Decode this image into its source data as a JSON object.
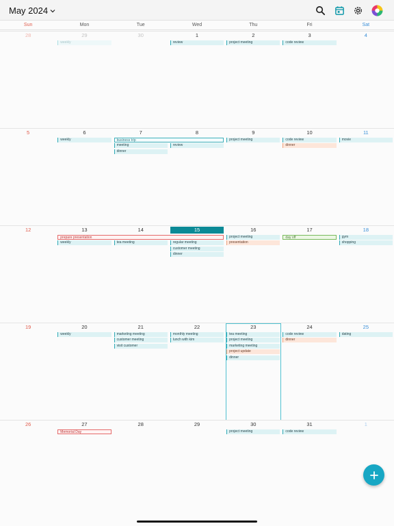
{
  "header": {
    "month_label": "May 2024",
    "icons": [
      "search-icon",
      "calendar-today-icon",
      "gear-icon",
      "color-wheel-icon"
    ],
    "accent_color": "#1199aa"
  },
  "weekdays": [
    "Sun",
    "Mon",
    "Tue",
    "Wed",
    "Thu",
    "Fri",
    "Sat"
  ],
  "weeks": [
    {
      "days": [
        {
          "num": "28",
          "muted": true
        },
        {
          "num": "29",
          "muted": true
        },
        {
          "num": "30",
          "muted": true
        },
        {
          "num": "1"
        },
        {
          "num": "2"
        },
        {
          "num": "3"
        },
        {
          "num": "4"
        }
      ],
      "events": [
        {
          "label": "weekly",
          "day": 1,
          "row": 0,
          "style": "std faded"
        },
        {
          "label": "review",
          "day": 3,
          "row": 0,
          "style": "std"
        },
        {
          "label": "project meeting",
          "day": 4,
          "row": 0,
          "style": "std"
        },
        {
          "label": "code review",
          "day": 5,
          "row": 0,
          "style": "std"
        }
      ]
    },
    {
      "days": [
        {
          "num": "5"
        },
        {
          "num": "6"
        },
        {
          "num": "7"
        },
        {
          "num": "8"
        },
        {
          "num": "9"
        },
        {
          "num": "10"
        },
        {
          "num": "11"
        }
      ],
      "events": [
        {
          "label": "weekly",
          "day": 1,
          "row": 0,
          "style": "std"
        },
        {
          "label": "business trip",
          "day": 2,
          "span": 2,
          "row": 0,
          "style": "outline-teal"
        },
        {
          "label": "project meeting",
          "day": 4,
          "row": 0,
          "style": "std"
        },
        {
          "label": "code review",
          "day": 5,
          "row": 0,
          "style": "std"
        },
        {
          "label": "movie",
          "day": 6,
          "row": 0,
          "style": "std"
        },
        {
          "label": "meeting",
          "day": 2,
          "row": 1,
          "style": "std"
        },
        {
          "label": "review",
          "day": 3,
          "row": 1,
          "style": "std"
        },
        {
          "label": "dinner",
          "day": 5,
          "row": 1,
          "style": "peach"
        },
        {
          "label": "dinner",
          "day": 2,
          "row": 2,
          "style": "std"
        }
      ]
    },
    {
      "days": [
        {
          "num": "12"
        },
        {
          "num": "13"
        },
        {
          "num": "14"
        },
        {
          "num": "15",
          "today": true
        },
        {
          "num": "16"
        },
        {
          "num": "17"
        },
        {
          "num": "18"
        }
      ],
      "events": [
        {
          "label": "prepare presentation",
          "day": 1,
          "span": 3,
          "row": 0,
          "style": "outline-red"
        },
        {
          "label": "project meeting",
          "day": 4,
          "row": 0,
          "style": "std"
        },
        {
          "label": "day off",
          "day": 5,
          "row": 0,
          "style": "outline-green"
        },
        {
          "label": "gym",
          "day": 6,
          "row": 0,
          "style": "std"
        },
        {
          "label": "weekly",
          "day": 1,
          "row": 1,
          "style": "std"
        },
        {
          "label": "tea meeting",
          "day": 2,
          "row": 1,
          "style": "std"
        },
        {
          "label": "regular meeting",
          "day": 3,
          "row": 1,
          "style": "std"
        },
        {
          "label": "presentation",
          "day": 4,
          "row": 1,
          "style": "peach"
        },
        {
          "label": "shopping",
          "day": 6,
          "row": 1,
          "style": "std"
        },
        {
          "label": "customer meeting",
          "day": 3,
          "row": 2,
          "style": "std"
        },
        {
          "label": "dinner",
          "day": 3,
          "row": 3,
          "style": "std"
        }
      ]
    },
    {
      "selected_day": 4,
      "days": [
        {
          "num": "19"
        },
        {
          "num": "20"
        },
        {
          "num": "21"
        },
        {
          "num": "22"
        },
        {
          "num": "23"
        },
        {
          "num": "24"
        },
        {
          "num": "25"
        }
      ],
      "events": [
        {
          "label": "weekly",
          "day": 1,
          "row": 0,
          "style": "std"
        },
        {
          "label": "marketing meeting",
          "day": 2,
          "row": 0,
          "style": "std"
        },
        {
          "label": "monthly meeting",
          "day": 3,
          "row": 0,
          "style": "std"
        },
        {
          "label": "tea meeting",
          "day": 4,
          "row": 0,
          "style": "std"
        },
        {
          "label": "code review",
          "day": 5,
          "row": 0,
          "style": "std"
        },
        {
          "label": "dating",
          "day": 6,
          "row": 0,
          "style": "std"
        },
        {
          "label": "customer meeting",
          "day": 2,
          "row": 1,
          "style": "std"
        },
        {
          "label": "lunch with kim",
          "day": 3,
          "row": 1,
          "style": "std"
        },
        {
          "label": "project meeting",
          "day": 4,
          "row": 1,
          "style": "std"
        },
        {
          "label": "dinner",
          "day": 5,
          "row": 1,
          "style": "peach"
        },
        {
          "label": "visit customer",
          "day": 2,
          "row": 2,
          "style": "std"
        },
        {
          "label": "marketing meeting",
          "day": 4,
          "row": 2,
          "style": "std"
        },
        {
          "label": "project update",
          "day": 4,
          "row": 3,
          "style": "peach"
        },
        {
          "label": "dinner",
          "day": 4,
          "row": 4,
          "style": "std"
        }
      ]
    },
    {
      "days": [
        {
          "num": "26"
        },
        {
          "num": "27"
        },
        {
          "num": "28"
        },
        {
          "num": "29"
        },
        {
          "num": "30"
        },
        {
          "num": "31"
        },
        {
          "num": "1",
          "muted": true
        }
      ],
      "events": [
        {
          "label": "Memorial Day",
          "day": 1,
          "row": 0,
          "style": "outline-red"
        },
        {
          "label": "project meeting",
          "day": 4,
          "row": 0,
          "style": "std"
        },
        {
          "label": "code review",
          "day": 5,
          "row": 0,
          "style": "std"
        }
      ]
    }
  ]
}
